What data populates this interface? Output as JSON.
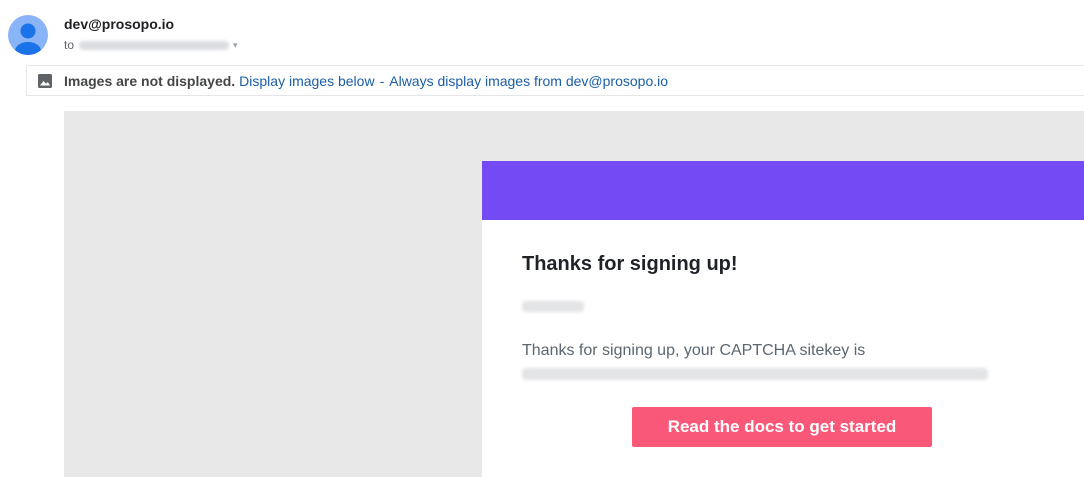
{
  "header": {
    "sender": "dev@prosopo.io",
    "to_label": "to",
    "recipient_caret": "▾"
  },
  "images_bar": {
    "icon": "image-icon",
    "warning": "Images are not displayed.",
    "display_below": "Display images below",
    "separator": "-",
    "always_display": "Always display images from dev@prosopo.io"
  },
  "email": {
    "title": "Thanks for signing up!",
    "message": "Thanks for signing up, your CAPTCHA sitekey is",
    "cta": "Read the docs to get started"
  },
  "colors": {
    "header_band": "#744af4",
    "cta": "#fa5879",
    "link": "#1a5ea8",
    "avatar": "#8ab4f8"
  }
}
